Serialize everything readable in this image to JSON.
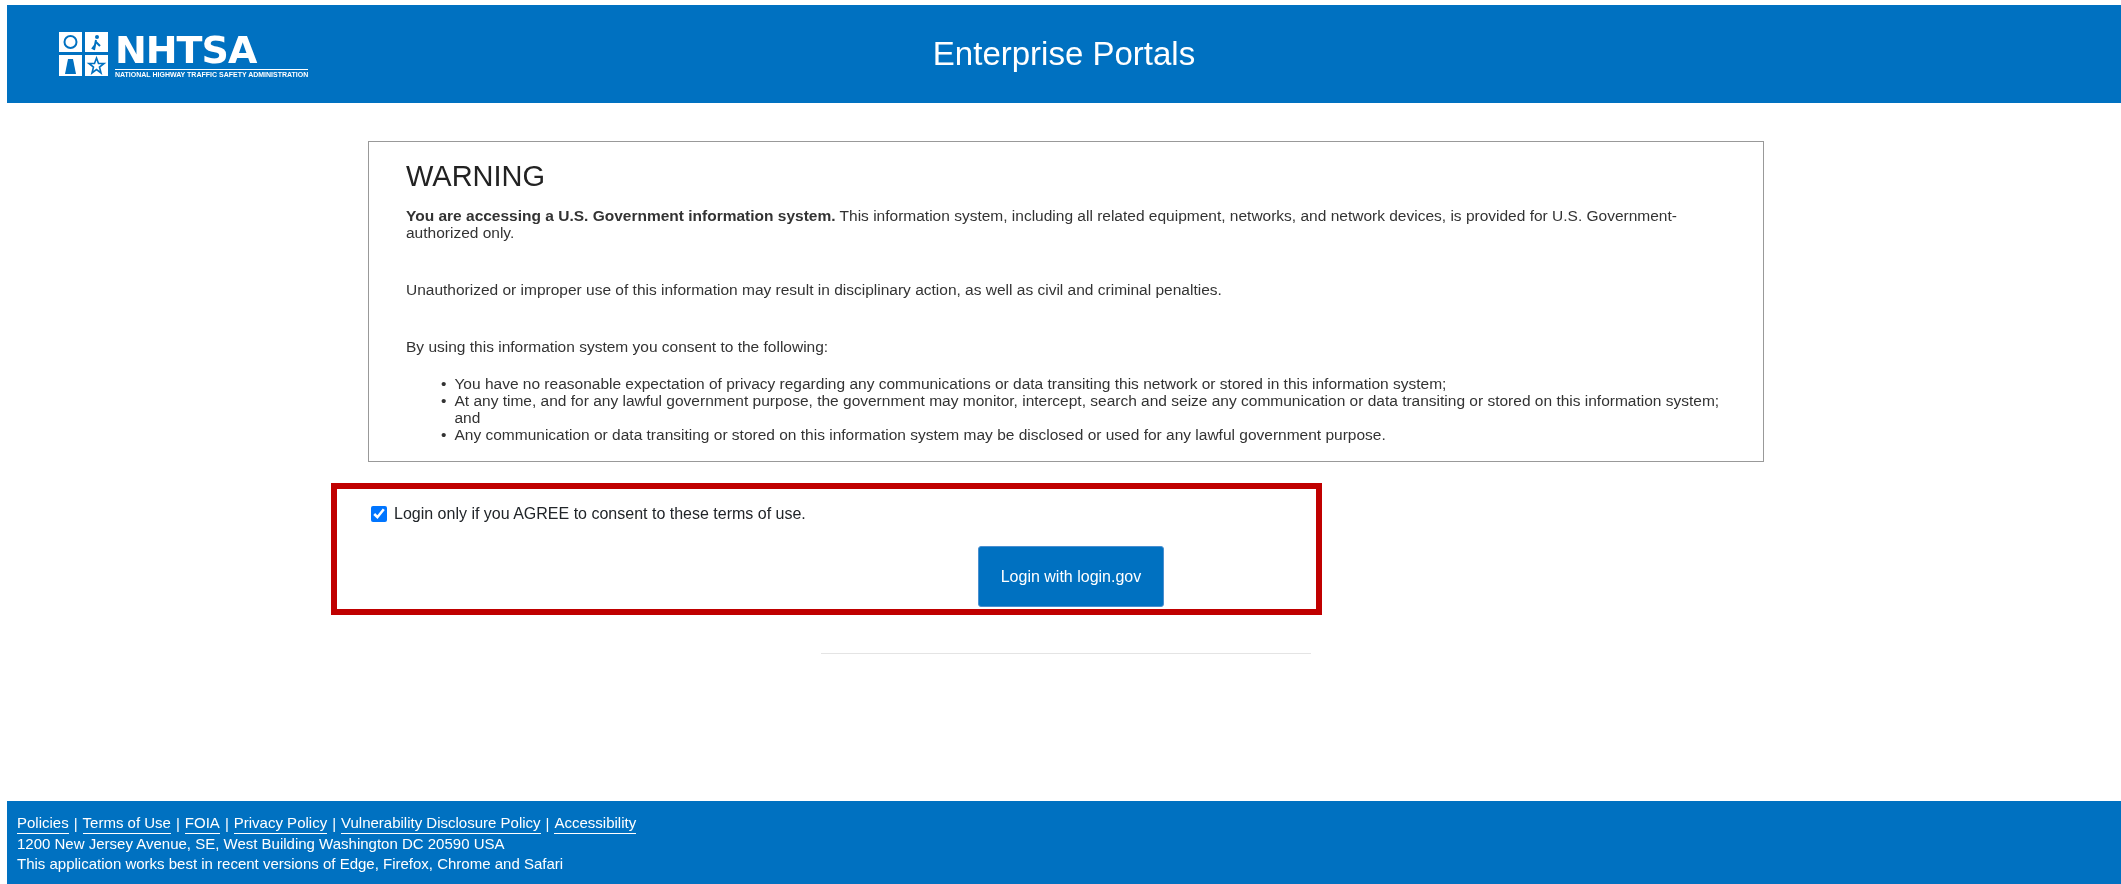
{
  "header": {
    "logo_text": "NHTSA",
    "logo_subtitle": "NATIONAL HIGHWAY TRAFFIC SAFETY ADMINISTRATION",
    "title": "Enterprise Portals"
  },
  "warning": {
    "heading": "WARNING",
    "paragraphs": [
      "**You are accessing a U.S. Government information system.** This information system, including all related equipment, networks, and network devices, is provided for U.S. Government-authorized only.",
      "Unauthorized or improper use of this information may result in disciplinary action, as well as civil and criminal penalties.",
      "By using this information system you consent to the following:"
    ],
    "bullet_marker": "•",
    "bullets": [
      "You have no reasonable expectation of privacy regarding any communications or data transiting this network or stored in this information system;",
      "At any time, and for any lawful government purpose, the government may monitor, intercept, search and seize any communication or data transiting or stored on this information system; and",
      "Any communication or data transiting or stored on this information system may be disclosed or used for any lawful government purpose."
    ]
  },
  "consent": {
    "label": "Login only if you AGREE to consent to these terms of use.",
    "checked": true
  },
  "login_button": "Login with login.gov",
  "footer": {
    "links": [
      "Policies",
      "Terms of Use",
      "FOIA",
      "Privacy Policy",
      "Vulnerability Disclosure Policy",
      "Accessibility"
    ],
    "separator": "|",
    "address": "1200 New Jersey Avenue, SE, West Building Washington DC 20590 USA",
    "note": "This application works best in recent versions of Edge, Firefox, Chrome and Safari"
  }
}
